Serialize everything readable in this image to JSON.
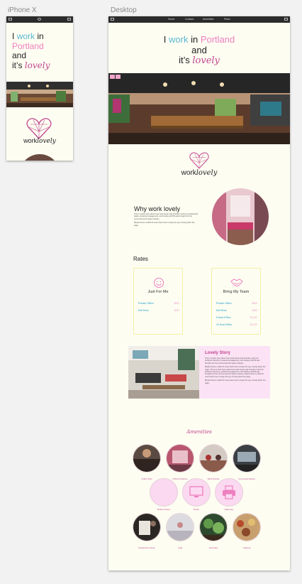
{
  "artboards": {
    "phone_label": "iPhone X",
    "desktop_label": "Desktop"
  },
  "phone": {
    "title_1": "I",
    "title_work": "work",
    "title_in": "in",
    "title_city": "Portland",
    "title_and": "and",
    "title_its": "it’s",
    "title_lovely": "lovely",
    "logo_work": "work",
    "logo_lovely": "lovely"
  },
  "desktop": {
    "nav": [
      "Home",
      "Contact",
      "Amenities",
      "Plans"
    ],
    "title_1": "I",
    "title_work": "work",
    "title_in": "in",
    "title_city": "Portland",
    "title_and": "and",
    "title_its": "it’s",
    "title_lovely": "lovely",
    "logo_work": "work",
    "logo_lovely": "lovely",
    "why": {
      "heading": "Why work lovely",
      "p1": "This is a short story about how work lovely was founded, and how professional desks, protected engagement, and hockey stuff fill was brought into the communal work space industry.",
      "p2": "Maybe there’s a little bit more down here to keep the eye moving down the page."
    },
    "rates": {
      "heading": "Rates",
      "cards": [
        {
          "title": "Just For Me",
          "rows": [
            {
              "name": "Private Office",
              "price": "$500"
            },
            {
              "name": "Hot Desk",
              "price": "$200"
            }
          ]
        },
        {
          "title": "Bring My Team",
          "rows": [
            {
              "name": "Private Office",
              "price": "$800"
            },
            {
              "name": "Hot Desk",
              "price": "$350"
            },
            {
              "name": "5 Seat Office",
              "price": "$1,800"
            },
            {
              "name": "10 Seat Office",
              "price": "$3,000"
            }
          ]
        }
      ]
    },
    "story": {
      "heading": "Lovely Story",
      "p1": "This is a short story about how work lovely was founded, and how lumbpors directory, protected engagement, and hockey stuff fill was brought into the communal work space industry.",
      "p2": "Maybe there’s a little bit more down here to keep the eye moving down the page. This is a short story about how work lovely was founded, and how lumbpors directory, protected engagement, and hockey stuff fill was brought into the communal work space industry. Maybe there’s a little bit more down here to keep the eye moving down the page.",
      "p3": "Maybe there’s a little bit more down here to keep the eye moving down the page."
    },
    "amenities": {
      "heading": "Amenities",
      "items": [
        {
          "label": "Coffee Shop"
        },
        {
          "label": "Airbnb Ambiance"
        },
        {
          "label": "Work Friends"
        },
        {
          "label": "Communal Spaces"
        },
        {
          "label": "Mothers Room"
        },
        {
          "label": "Printer"
        },
        {
          "label": "Stationary"
        },
        {
          "label": "Restaurant Access"
        },
        {
          "label": "Yoga"
        },
        {
          "label": "Amenities"
        },
        {
          "label": "Catering"
        }
      ]
    }
  },
  "colors": {
    "blue": "#5ab8d3",
    "pink": "#ee7fbf",
    "magenta": "#c2458e",
    "cream": "#fdfdf2",
    "story_bg": "#fbe3f5",
    "card_border": "#f3f0a6"
  }
}
